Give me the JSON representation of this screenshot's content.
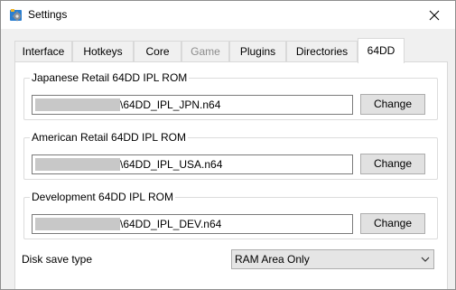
{
  "window": {
    "title": "Settings",
    "close_glyph": "✕"
  },
  "tabs": [
    {
      "label": "Interface",
      "state": "normal"
    },
    {
      "label": "Hotkeys",
      "state": "normal"
    },
    {
      "label": "Core",
      "state": "normal"
    },
    {
      "label": "Game",
      "state": "disabled"
    },
    {
      "label": "Plugins",
      "state": "normal"
    },
    {
      "label": "Directories",
      "state": "normal"
    },
    {
      "label": "64DD",
      "state": "active"
    }
  ],
  "rom_groups": [
    {
      "title": "Japanese Retail 64DD IPL ROM",
      "path_visible": "\\64DD_IPL_JPN.n64",
      "button_label": "Change"
    },
    {
      "title": "American Retail 64DD IPL ROM",
      "path_visible": "\\64DD_IPL_USA.n64",
      "button_label": "Change"
    },
    {
      "title": "Development 64DD IPL ROM",
      "path_visible": "\\64DD_IPL_DEV.n64",
      "button_label": "Change"
    }
  ],
  "disk_save": {
    "label": "Disk save type",
    "selected": "RAM Area Only"
  },
  "colors": {
    "redaction": "#c8c8c8",
    "app_icon_blue": "#2b7fd0",
    "app_icon_gear": "#8a8f96"
  },
  "icons": {
    "app": "settings-gear-icon",
    "close": "close-icon",
    "dropdown": "chevron-down-icon"
  }
}
